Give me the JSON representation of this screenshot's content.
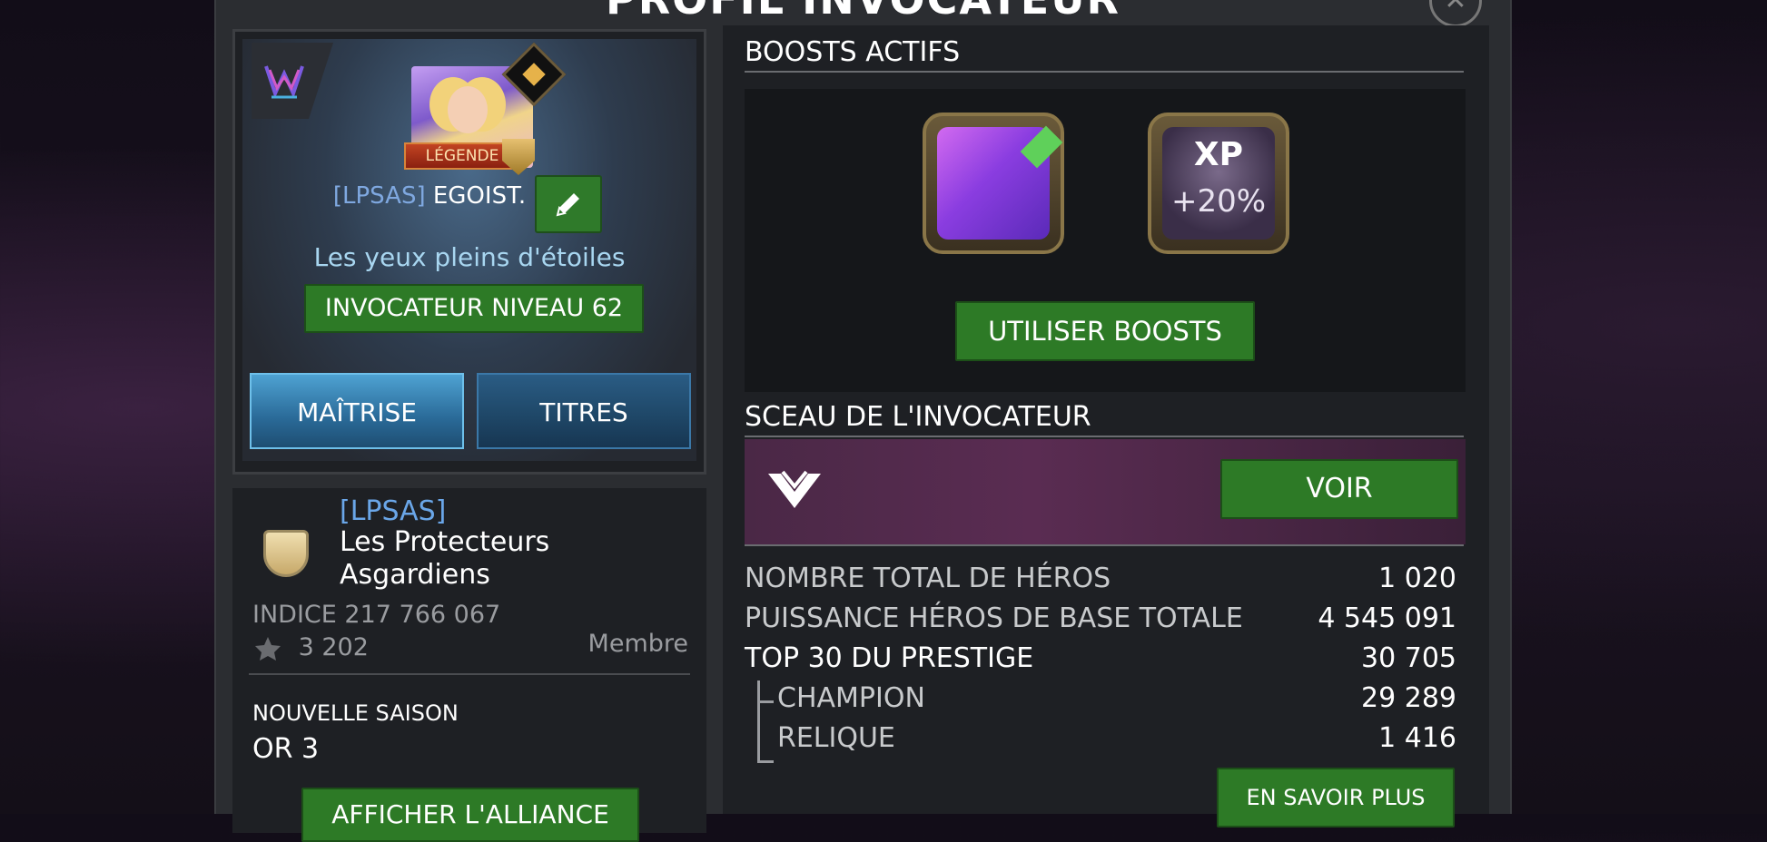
{
  "window": {
    "title": "PROFIL INVOCATEUR"
  },
  "profile": {
    "rank_badge": "LÉGENDE",
    "alliance_tag": "[LPSAS]",
    "name": "EGOIST.",
    "player_title": "Les yeux pleins d'étoiles",
    "level_label": "INVOCATEUR NIVEAU 62",
    "tabs": [
      {
        "label": "MAÎTRISE"
      },
      {
        "label": "TITRES"
      }
    ]
  },
  "alliance": {
    "tag": "[LPSAS]",
    "name": "Les Protecteurs Asgardiens",
    "indice": "INDICE 217 766 067",
    "score": "3 202",
    "role": "Membre",
    "season_label": "NOUVELLE SAISON",
    "season_value": "OR 3",
    "button_label": "AFFICHER L'ALLIANCE"
  },
  "boosts": {
    "section_title": "BOOSTS ACTIFS",
    "items": [
      {
        "icon": "boost-crystal-icon"
      },
      {
        "icon": "xp-boost-icon",
        "xp_label": "XP",
        "percent": "+20%"
      }
    ],
    "use_button": "UTILISER BOOSTS"
  },
  "seal": {
    "section_title": "SCEAU DE L'INVOCATEUR",
    "button": "VOIR"
  },
  "stats": [
    {
      "label": "NOMBRE TOTAL DE HÉROS",
      "value": "1 020"
    },
    {
      "label": "PUISSANCE HÉROS DE BASE TOTALE",
      "value": "4 545 091"
    },
    {
      "label": "TOP 30 DU PRESTIGE",
      "value": "30 705"
    },
    {
      "label": "CHAMPION",
      "value": "29 289"
    },
    {
      "label": "RELIQUE",
      "value": "1 416"
    }
  ],
  "learn_more_button": "EN SAVOIR PLUS",
  "colors": {
    "accent_green": "#2d7a26",
    "alliance_blue": "#6aa6e8",
    "title_cyan": "#a8d6f0"
  }
}
